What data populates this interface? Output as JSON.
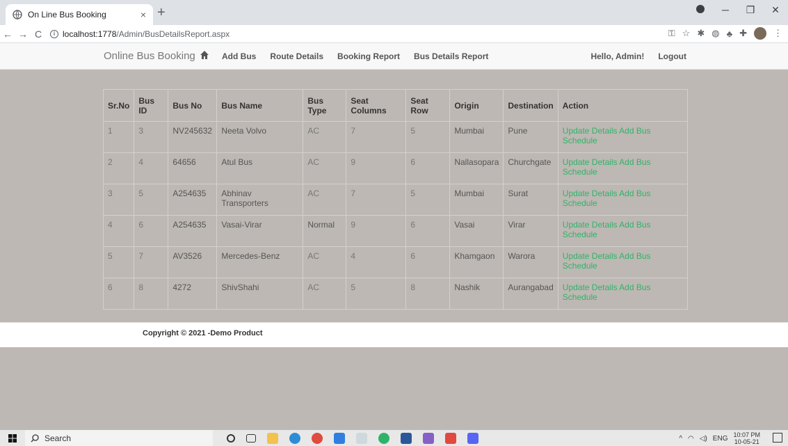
{
  "browser": {
    "tab_title": "On Line Bus Booking",
    "tab_close": "×",
    "new_tab": "+",
    "url_host": "localhost:1778",
    "url_path": "/Admin/BusDetailsReport.aspx",
    "back": "←",
    "forward": "→",
    "reload": "C"
  },
  "navbar": {
    "brand": "Online Bus Booking",
    "links": [
      "Add Bus",
      "Route Details",
      "Booking Report",
      "Bus Details Report"
    ],
    "greeting": "Hello, Admin!",
    "logout": "Logout"
  },
  "table": {
    "headers": [
      "Sr.No",
      "Bus ID",
      "Bus No",
      "Bus Name",
      "Bus Type",
      "Seat Columns",
      "Seat Row",
      "Origin",
      "Destination",
      "Action"
    ],
    "rows": [
      [
        "1",
        "3",
        "NV245632",
        "Neeta Volvo",
        "AC",
        "7",
        "5",
        "Mumbai",
        "Pune"
      ],
      [
        "2",
        "4",
        "64656",
        "Atul Bus",
        "AC",
        "9",
        "6",
        "Nallasopara",
        "Churchgate"
      ],
      [
        "3",
        "5",
        "A254635",
        "Abhinav Transporters",
        "AC",
        "7",
        "5",
        "Mumbai",
        "Surat"
      ],
      [
        "4",
        "6",
        "A254635",
        "Vasai-Virar",
        "Normal",
        "9",
        "6",
        "Vasai",
        "Virar"
      ],
      [
        "5",
        "7",
        "AV3526",
        "Mercedes-Benz",
        "AC",
        "4",
        "6",
        "Khamgaon",
        "Warora"
      ],
      [
        "6",
        "8",
        "4272",
        "ShivShahi",
        "AC",
        "5",
        "8",
        "Nashik",
        "Aurangabad"
      ]
    ],
    "action_update": "Update Details",
    "action_schedule": "Add Bus Schedule"
  },
  "footer": {
    "copyright": "Copyright © 2021 -Demo Product"
  },
  "taskbar": {
    "search_label": "Search",
    "language": "ENG",
    "time": "10:07 PM",
    "date": "10-05-21"
  },
  "colors": {
    "action_link": "#2fb36a",
    "page_background": "#bdb8b3",
    "navbar_background": "#f8f8f8"
  }
}
